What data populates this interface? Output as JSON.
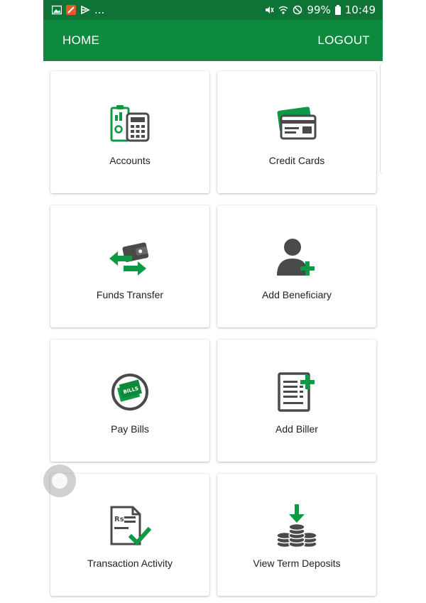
{
  "statusbar": {
    "left_icons": [
      "gallery-icon",
      "app-icon",
      "notification-icon"
    ],
    "more": "...",
    "battery": "99%",
    "time": "10:49",
    "right_icons": [
      "mute-icon",
      "wifi-icon",
      "dnd-icon",
      "battery-icon"
    ]
  },
  "appbar": {
    "home": "HOME",
    "logout": "LOGOUT"
  },
  "tiles": [
    {
      "label": "Accounts",
      "icon": "accounts-icon"
    },
    {
      "label": "Credit Cards",
      "icon": "credit-card-icon"
    },
    {
      "label": "Funds Transfer",
      "icon": "funds-transfer-icon"
    },
    {
      "label": "Add Beneficiary",
      "icon": "add-beneficiary-icon"
    },
    {
      "label": "Pay Bills",
      "icon": "pay-bills-icon"
    },
    {
      "label": "Add Biller",
      "icon": "add-biller-icon"
    },
    {
      "label": "Transaction Activity",
      "icon": "transaction-activity-icon"
    },
    {
      "label": "View Term Deposits",
      "icon": "term-deposits-icon"
    }
  ],
  "colors": {
    "primary": "#0e8a3e",
    "statusbar": "#0d7436",
    "icon_dark": "#4a4a4a",
    "icon_green": "#0e9a45"
  }
}
